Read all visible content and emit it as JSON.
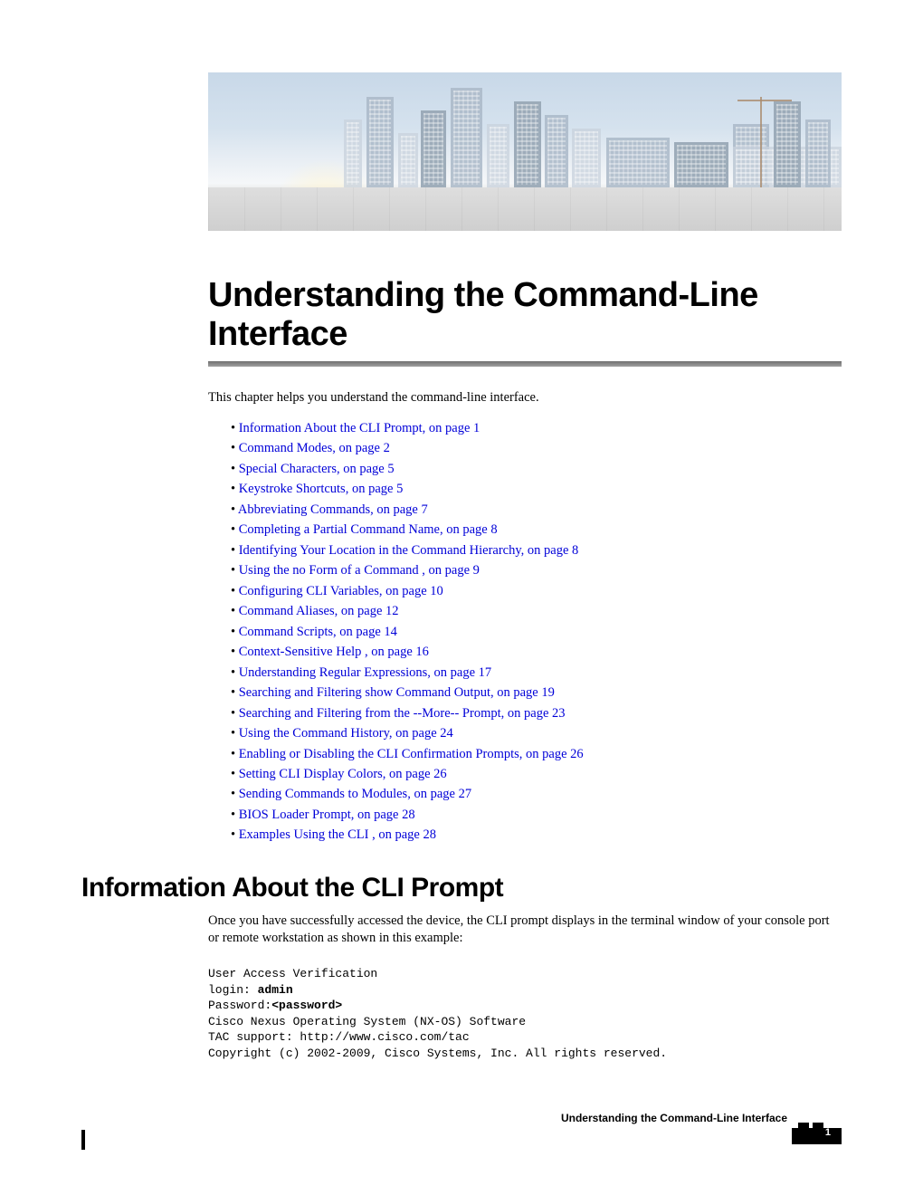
{
  "chapter": {
    "title": "Understanding the Command-Line Interface",
    "intro": "This chapter helps you understand the command-line interface."
  },
  "toc": [
    "Information About the CLI Prompt, on page 1",
    "Command Modes, on page 2",
    "Special Characters, on page 5",
    "Keystroke Shortcuts, on page 5",
    "Abbreviating Commands, on page 7",
    "Completing a Partial Command Name, on page 8",
    "Identifying Your Location in the Command Hierarchy, on page 8",
    "Using the no Form of a Command , on page 9",
    "Configuring CLI Variables, on page 10",
    "Command Aliases, on page 12",
    "Command Scripts, on page 14",
    "Context-Sensitive Help , on page 16",
    "Understanding Regular Expressions, on page 17",
    "Searching and Filtering show Command Output, on page 19",
    "Searching and Filtering from the --More-- Prompt, on page 23",
    "Using the Command History, on page 24",
    "Enabling or Disabling the CLI Confirmation Prompts, on page 26",
    "Setting CLI Display Colors, on page 26",
    "Sending Commands to Modules, on page 27",
    "BIOS Loader Prompt, on page 28",
    "Examples Using the CLI , on page 28"
  ],
  "section1": {
    "title": "Information About the CLI Prompt",
    "p1": "Once you have successfully accessed the device, the CLI prompt displays in the terminal window of your console port or remote workstation as shown in this example:"
  },
  "code": {
    "l1": "User Access Verification",
    "l2a": "login: ",
    "l2b": "admin",
    "l3a": "Password:",
    "l3b": "<password>",
    "l4": "Cisco Nexus Operating System (NX-OS) Software",
    "l5": "TAC support: http://www.cisco.com/tac",
    "l6": "Copyright (c) 2002-2009, Cisco Systems, Inc. All rights reserved."
  },
  "footer": {
    "title": "Understanding the Command-Line Interface",
    "page": "1"
  }
}
